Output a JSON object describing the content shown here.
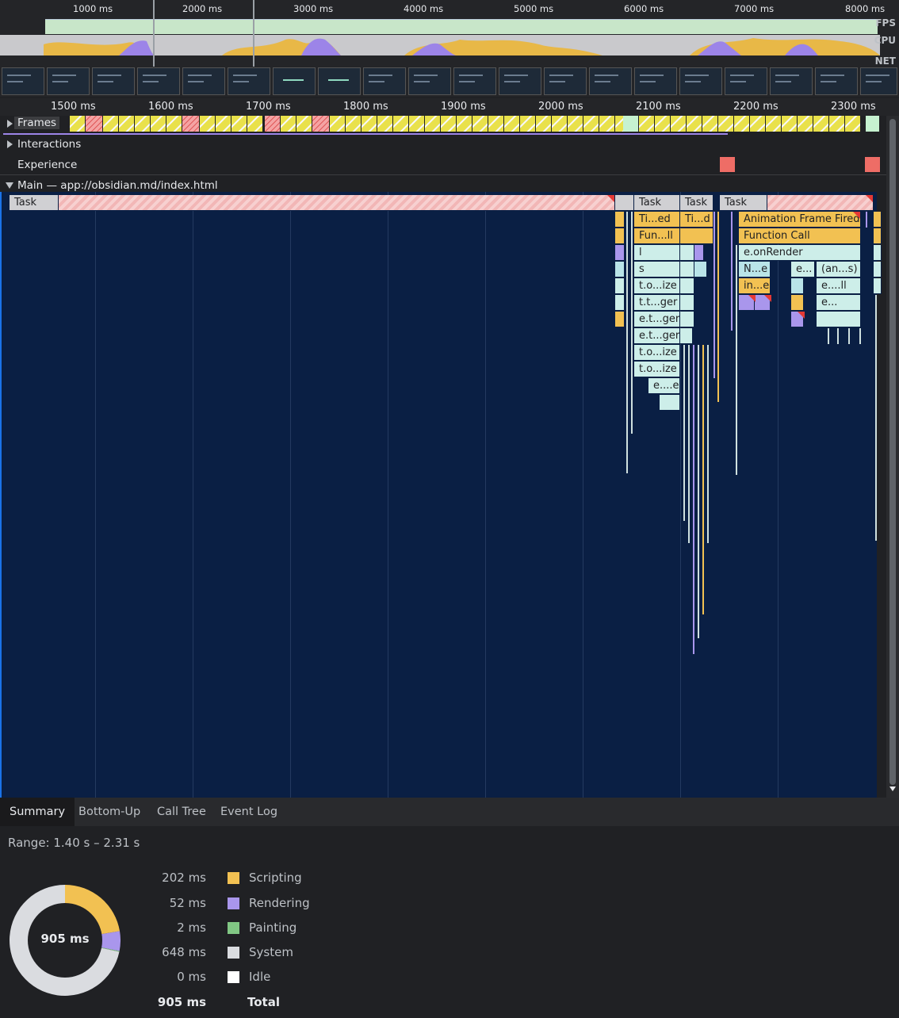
{
  "overview": {
    "ticks": [
      "1000 ms",
      "2000 ms",
      "3000 ms",
      "4000 ms",
      "5000 ms",
      "6000 ms",
      "7000 ms",
      "8000 ms"
    ],
    "labels": {
      "fps": "FPS",
      "cpu": "CPU",
      "net": "NET"
    }
  },
  "ruler": {
    "ticks": [
      "1500 ms",
      "1600 ms",
      "1700 ms",
      "1800 ms",
      "1900 ms",
      "2000 ms",
      "2100 ms",
      "2200 ms",
      "2300 ms"
    ]
  },
  "tracks": {
    "frames": "Frames",
    "interactions": "Interactions",
    "experience": "Experience",
    "main": "Main — app://obsidian.md/index.html"
  },
  "flame": {
    "task_labels": [
      "Task",
      "Task",
      "Task",
      "Task"
    ],
    "col1": [
      "Ti...ed",
      "Fun...ll",
      "l",
      "s",
      "t.o...ize",
      "t.t...ger",
      "e.t...ger",
      "e.t...ger",
      "t.o...ize",
      "t.o...ize",
      "e....e"
    ],
    "col2": [
      "Ti...d"
    ],
    "col3": [
      "Animation Frame Fired",
      "Function Call",
      "e.onRender",
      "N...e",
      "e...",
      "(an...s)",
      "in...e",
      "e....ll",
      "e..."
    ]
  },
  "tabs": [
    "Summary",
    "Bottom-Up",
    "Call Tree",
    "Event Log"
  ],
  "summary": {
    "range": "Range: 1.40 s – 2.31 s",
    "donut_label": "905 ms",
    "rows": [
      {
        "value": "202 ms",
        "name": "Scripting",
        "color": "#f2c152",
        "ms": 202
      },
      {
        "value": "52 ms",
        "name": "Rendering",
        "color": "#a996ec",
        "ms": 52
      },
      {
        "value": "2 ms",
        "name": "Painting",
        "color": "#81c784",
        "ms": 2
      },
      {
        "value": "648 ms",
        "name": "System",
        "color": "#dadce0",
        "ms": 648
      },
      {
        "value": "0 ms",
        "name": "Idle",
        "color": "#ffffff",
        "ms": 0
      }
    ],
    "total_value": "905 ms",
    "total_label": "Total"
  }
}
